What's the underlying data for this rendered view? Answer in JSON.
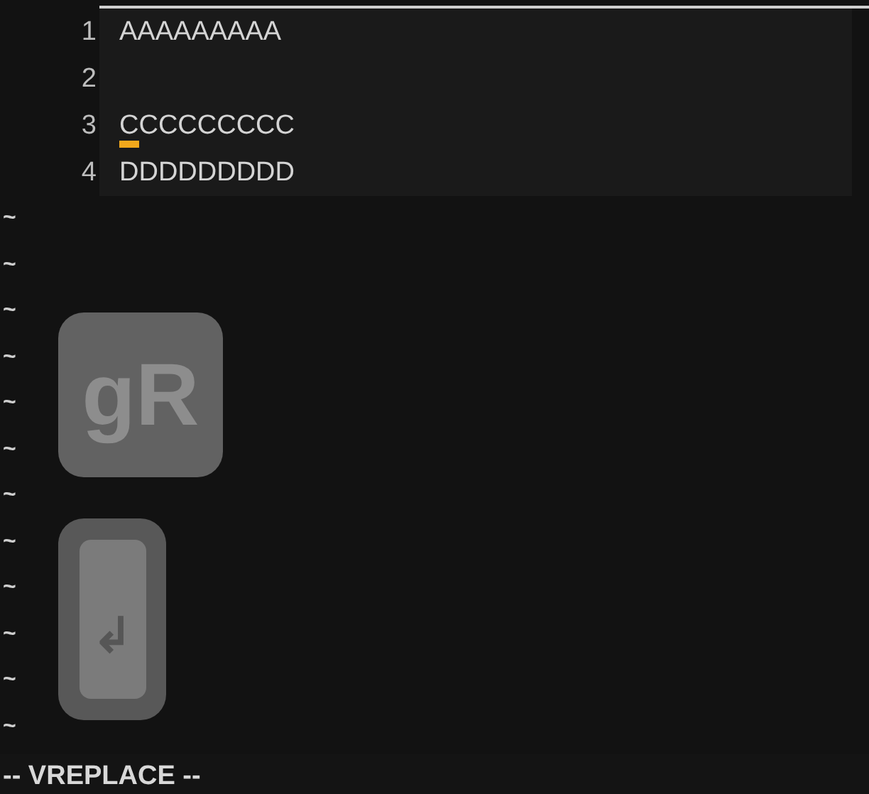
{
  "editor": {
    "lines": [
      {
        "number": "1",
        "text": "AAAAAAAAA",
        "cursor": false
      },
      {
        "number": "2",
        "cursor": false
      },
      {
        "number": "3",
        "text": "CCCCCCCCC",
        "cursor": true
      },
      {
        "number": "4",
        "text": "DDDDDDDDD",
        "cursor": false
      }
    ],
    "filler": [
      "~",
      "~",
      "~",
      "~",
      "~",
      "~",
      "~",
      "~",
      "~",
      "~",
      "~",
      "~"
    ]
  },
  "keys": [
    {
      "kind": "text",
      "label": "gR"
    },
    {
      "kind": "glyph",
      "label": "↲"
    }
  ],
  "status_bar": {
    "mode": "-- VREPLACE --"
  }
}
